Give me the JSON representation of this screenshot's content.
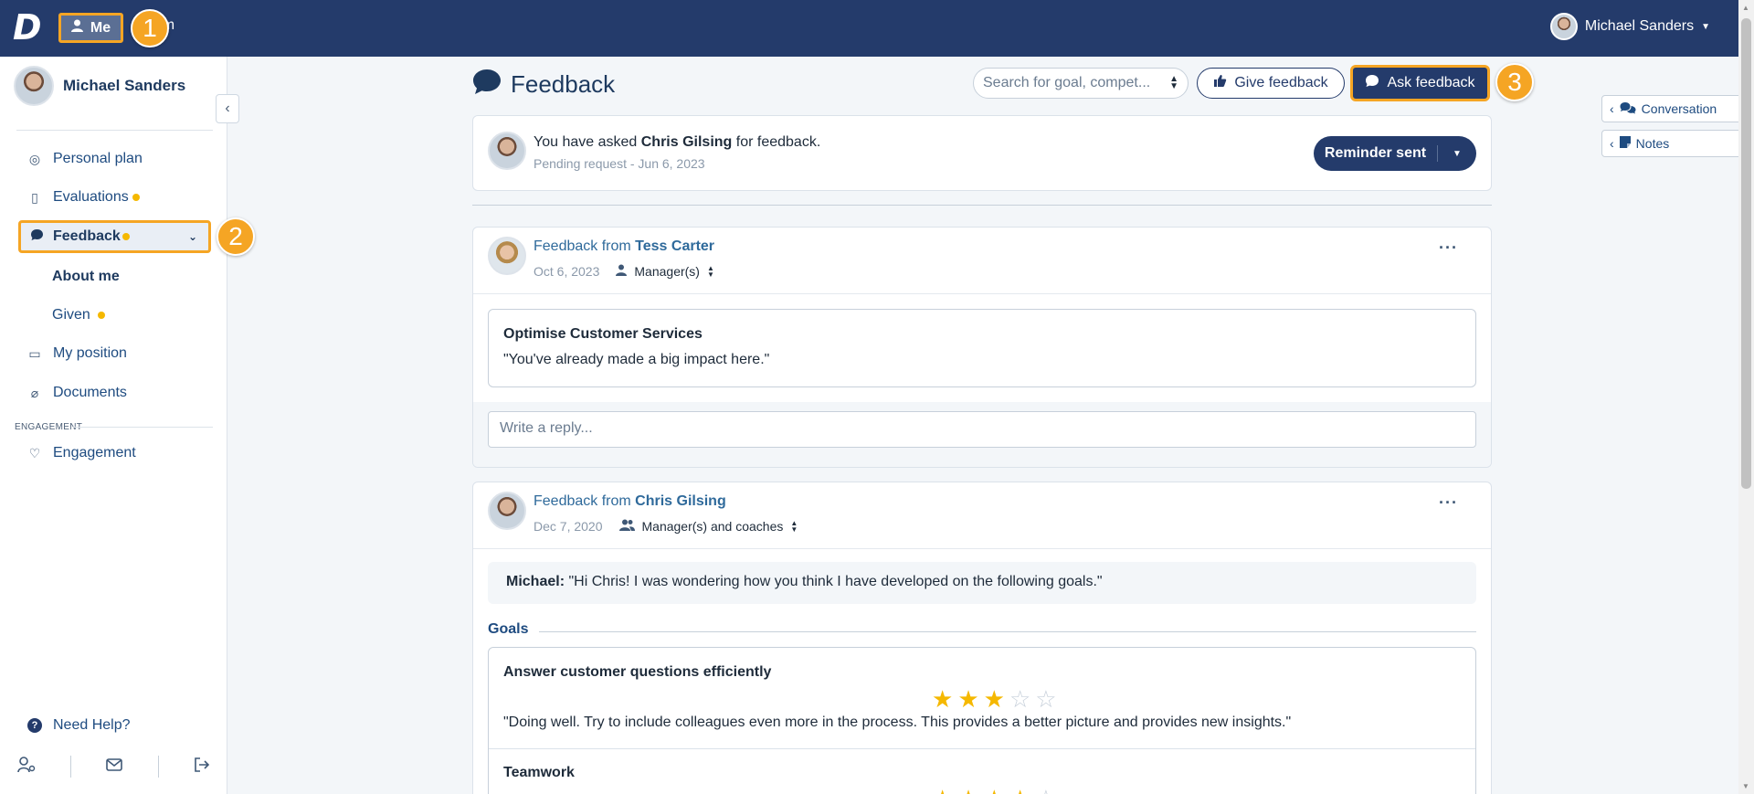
{
  "header": {
    "logo": "D",
    "me_label": "Me",
    "team_label": "eam",
    "user_name": "Michael Sanders",
    "steps": [
      "1",
      "2",
      "3"
    ]
  },
  "sidebar": {
    "profile_name": "Michael Sanders",
    "items": [
      {
        "label": "Personal plan",
        "icon": "target-icon"
      },
      {
        "label": "Evaluations",
        "icon": "document-icon",
        "badge": true
      },
      {
        "label": "Feedback",
        "icon": "chat-bubble-icon",
        "badge": true,
        "active": true
      },
      {
        "label": "About me",
        "sub": true
      },
      {
        "label": "Given",
        "sub": true,
        "badge": true
      },
      {
        "label": "My position",
        "icon": "id-card-icon"
      },
      {
        "label": "Documents",
        "icon": "paperclip-icon"
      },
      {
        "label": "Engagement",
        "icon": "heart-pulse-icon"
      }
    ],
    "section_engagement": "ENGAGEMENT",
    "need_help": "Need Help?"
  },
  "main": {
    "title": "Feedback",
    "search_placeholder": "Search for goal, compet...",
    "give_feedback": "Give feedback",
    "ask_feedback": "Ask feedback",
    "request": {
      "prefix": "You have asked ",
      "person": "Chris Gilsing",
      "suffix": " for feedback.",
      "status": "Pending request - Jun 6, 2023",
      "button": "Reminder sent"
    },
    "feedback1": {
      "from_label": "Feedback from ",
      "from_name": "Tess Carter",
      "date": "Oct 6, 2023",
      "audience": "Manager(s)",
      "goal": "Optimise Customer Services",
      "quote": "\"You've already made a big impact here.\"",
      "reply_placeholder": "Write a reply..."
    },
    "feedback2": {
      "from_label": "Feedback from ",
      "from_name": "Chris Gilsing",
      "date": "Dec 7, 2020",
      "audience": "Manager(s) and coaches",
      "message_author": "Michael:",
      "message": " \"Hi Chris! I was wondering how you think I have developed on the following goals.\"",
      "goals_label": "Goals",
      "goals": [
        {
          "title": "Answer customer questions efficiently",
          "rating": 3,
          "max": 5,
          "comment": "\"Doing well. Try to include colleagues even more in the process. This provides a better picture and provides new insights.\""
        },
        {
          "title": "Teamwork",
          "rating": 4,
          "max": 5,
          "comment": ""
        }
      ]
    }
  },
  "right_panel": {
    "conversation": "Conversation",
    "notes": "Notes"
  },
  "colors": {
    "navy": "#243b6b",
    "accent": "#f5a524",
    "star": "#f5b800"
  }
}
